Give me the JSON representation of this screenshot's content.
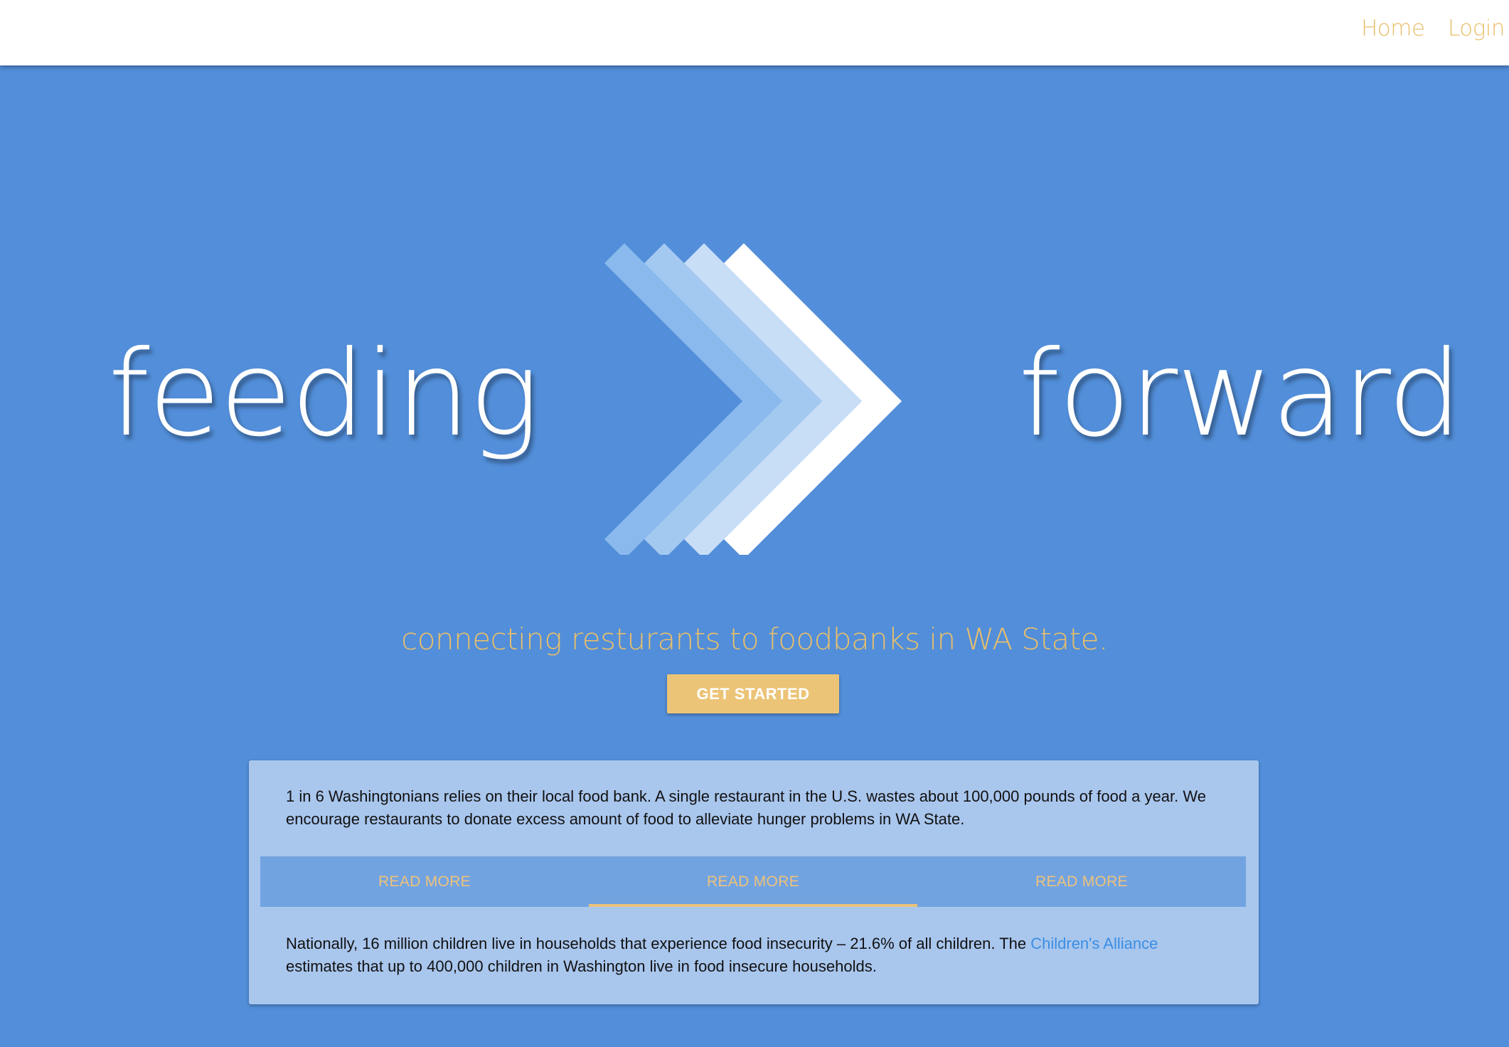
{
  "nav": {
    "home_label": "Home",
    "login_label": "Login"
  },
  "hero": {
    "word_left": "feeding",
    "word_right": "forward",
    "logo_icon": "chevron-arrows-icon"
  },
  "tagline": "connecting resturants to foodbanks in WA State.",
  "cta": {
    "label": "GET STARTED"
  },
  "info_card": {
    "intro_text": "1 in 6 Washingtonians relies on their local food bank. A single restaurant in the U.S. wastes about 100,000 pounds of food a year. We encourage restaurants to donate excess amount of food to alleviate hunger problems in WA State.",
    "tabs": [
      {
        "label": "READ MORE",
        "active": false
      },
      {
        "label": "READ MORE",
        "active": true
      },
      {
        "label": "READ MORE",
        "active": false
      }
    ],
    "detail_text_before": "Nationally, 16 million children live in households that experience food insecurity – 21.6% of all children. The ",
    "detail_link": "Children's Alliance",
    "detail_text_after": " estimates that up to 400,000 children in Washington live in food insecure households."
  },
  "colors": {
    "background": "#528ed9",
    "accent": "#e9bf6b",
    "card": "#a9c6ed",
    "tab_bar": "#72a3e1",
    "link": "#3b8ee3"
  }
}
